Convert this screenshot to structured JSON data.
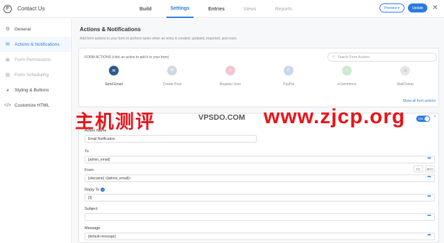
{
  "header": {
    "app_title": "Contact Us",
    "tabs": [
      {
        "label": "Build"
      },
      {
        "label": "Settings"
      },
      {
        "label": "Entries"
      },
      {
        "label": "Views"
      },
      {
        "label": "Reports"
      }
    ],
    "preview_label": "Preview ▾",
    "update_label": "Update",
    "close_glyph": "✕"
  },
  "sidebar": {
    "items": [
      {
        "label": "General",
        "icon": "gear-icon",
        "glyph": "⚙"
      },
      {
        "label": "Actions & Notifications",
        "icon": "bell-icon",
        "glyph": "✉"
      },
      {
        "label": "Form Permissions",
        "icon": "lock-icon",
        "glyph": "▣"
      },
      {
        "label": "Form Scheduling",
        "icon": "calendar-icon",
        "glyph": "▦"
      },
      {
        "label": "Styling & Buttons",
        "icon": "palette-icon",
        "glyph": "◕"
      },
      {
        "label": "Customize HTML",
        "icon": "code-icon",
        "glyph": "</>"
      }
    ]
  },
  "main": {
    "title": "Actions & Notifications",
    "description": "Add form actions to your form to perform tasks when an entry is created, updated, imported, and more.",
    "form_actions": {
      "label": "FORM ACTIONS (click an action to add it to your form)",
      "search_placeholder": "Search Form Actions",
      "actions": [
        {
          "label": "Send Email",
          "icon": "email-icon",
          "glyph": "✉",
          "color": "#2a5a8a"
        },
        {
          "label": "Create Post",
          "icon": "wordpress-icon",
          "glyph": "W",
          "color": "#cfd8e3"
        },
        {
          "label": "Register User",
          "icon": "user-icon",
          "glyph": "☺",
          "color": "#f1c6d2"
        },
        {
          "label": "PayPal",
          "icon": "paypal-icon",
          "glyph": "P",
          "color": "#c8d6ee"
        },
        {
          "label": "eCommerce",
          "icon": "cart-icon",
          "glyph": "≡",
          "color": "#cde9cf"
        },
        {
          "label": "MailChimp",
          "icon": "mailchimp-icon",
          "glyph": "☃",
          "color": "#e6e6e6"
        }
      ],
      "show_all": "Show all form actions"
    },
    "email": {
      "toggle": "ON",
      "action_name_label": "Action Name",
      "action_name_value": "Email Notification",
      "to_label": "To",
      "to_value": "[admin_email]",
      "from_label": "From",
      "from_value": "[sitename] <[admin_email]>",
      "cc_label": "CC",
      "bcc_label": "BCC",
      "reply_to_label": "Reply To",
      "reply_to_value": "[3]",
      "subject_label": "Subject",
      "subject_value": "",
      "message_label": "Message",
      "message_value": "[default-message]",
      "more_glyph": "•••"
    }
  },
  "watermark": {
    "cn_text": "主机测评",
    "mid_text": "VPSDO.COM",
    "url_text": "www.zjcp.org"
  },
  "colors": {
    "accent": "#2a7ae2",
    "watermark": "#e8141a"
  }
}
